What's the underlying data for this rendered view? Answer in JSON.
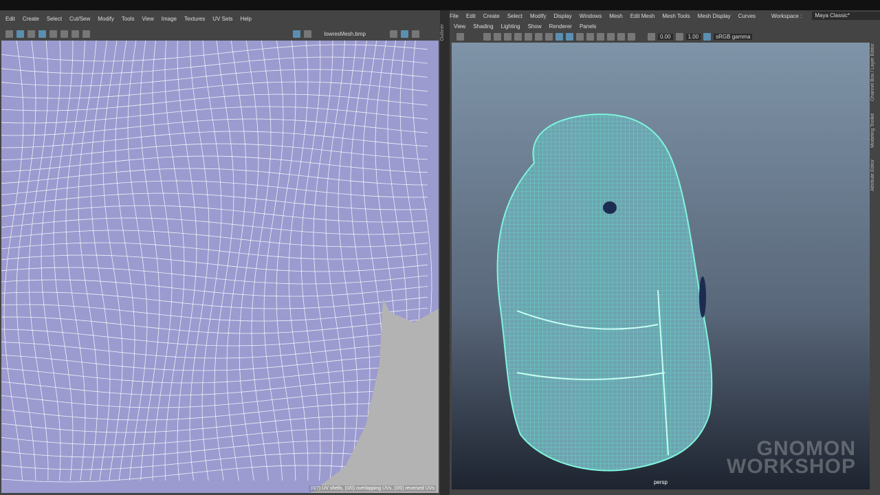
{
  "uv_editor": {
    "menu": [
      "Edit",
      "Create",
      "Select",
      "Cut/Sew",
      "Modify",
      "Tools",
      "View",
      "Image",
      "Textures",
      "UV Sets",
      "Help"
    ],
    "texture_name": "lowresMesh.bmp",
    "status": "(0/7) UV shells, (0/0) overlapping UVs, (0/0) reversed UVs"
  },
  "maya": {
    "menu": [
      "File",
      "Edit",
      "Create",
      "Select",
      "Modify",
      "Display",
      "Windows",
      "Mesh",
      "Edit Mesh",
      "Mesh Tools",
      "Mesh Display",
      "Curves"
    ],
    "workspace_label": "Workspace :",
    "workspace_value": "Maya Classic*",
    "panel_menu": [
      "View",
      "Shading",
      "Lighting",
      "Show",
      "Renderer",
      "Panels"
    ],
    "exposure": "0.00",
    "gamma": "1.00",
    "color_space": "sRGB gamma",
    "camera": "persp",
    "side_tabs": [
      "Channel Box / Layer Editor",
      "Modeling Toolkit",
      "Attribute Editor"
    ],
    "left_tab": "Outliner"
  },
  "watermark": [
    "GNOMON",
    "WORKSHOP"
  ],
  "colors": {
    "uv_bg": "#9b9bd0",
    "mesh": "#5fe0c8"
  }
}
